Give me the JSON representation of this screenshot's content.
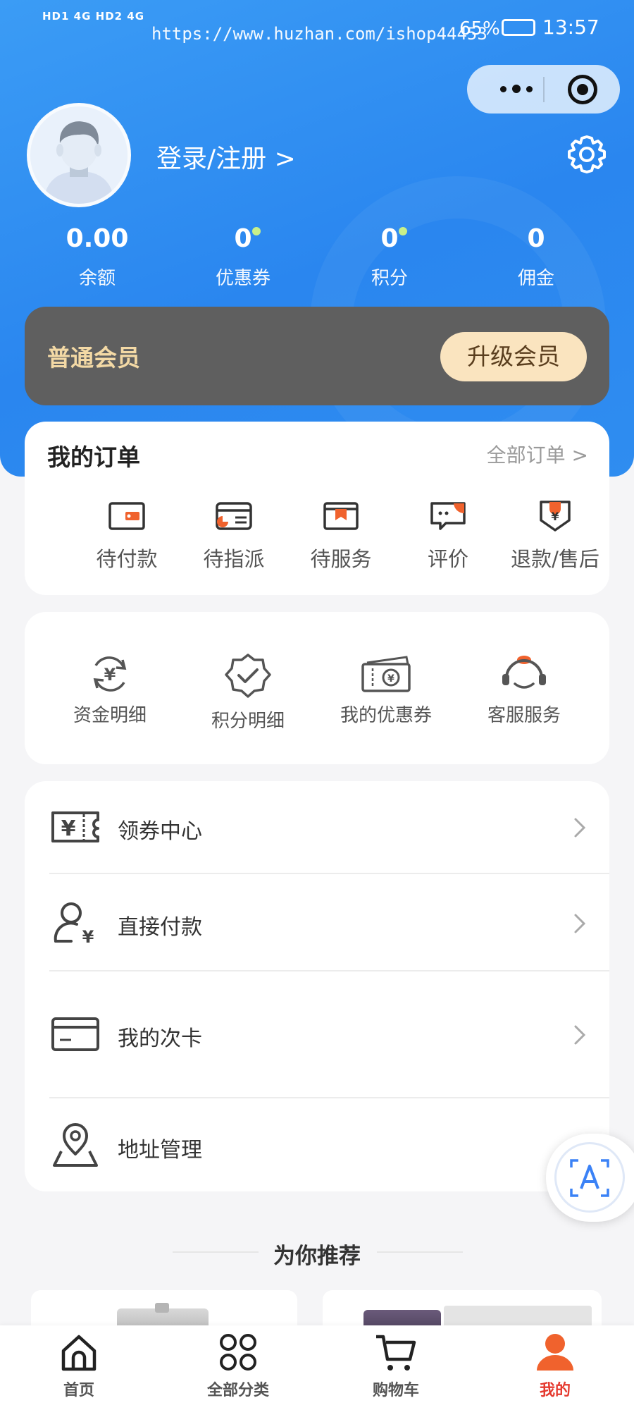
{
  "status_bar": {
    "network": "HD1 4G  HD2 4G",
    "watermark_url": "https://www.huzhan.com/ishop44453",
    "battery": "65%",
    "time": "13:57"
  },
  "header": {
    "login_label": "登录/注册 >",
    "stats": [
      {
        "value": "0.00",
        "label": "余额"
      },
      {
        "value": "0",
        "label": "优惠券"
      },
      {
        "value": "0",
        "label": "积分"
      },
      {
        "value": "0",
        "label": "佣金"
      }
    ]
  },
  "membership": {
    "level": "普通会员",
    "upgrade_label": "升级会员"
  },
  "orders": {
    "title": "我的订单",
    "all_label": "全部订单 >",
    "items": [
      {
        "label": "待付款",
        "icon": "wallet-icon"
      },
      {
        "label": "待指派",
        "icon": "card-icon"
      },
      {
        "label": "待服务",
        "icon": "box-icon"
      },
      {
        "label": "评价",
        "icon": "comment-icon"
      },
      {
        "label": "退款/售后",
        "icon": "refund-icon"
      }
    ]
  },
  "tools": [
    {
      "label": "资金明细",
      "icon": "funds-icon"
    },
    {
      "label": "积分明细",
      "icon": "badge-check-icon"
    },
    {
      "label": "我的优惠券",
      "icon": "ticket-icon"
    },
    {
      "label": "客服服务",
      "icon": "customer-service-icon"
    }
  ],
  "menu": [
    {
      "label": "领券中心",
      "icon": "coupon-icon"
    },
    {
      "label": "直接付款",
      "icon": "user-pay-icon"
    },
    {
      "label": "我的次卡",
      "icon": "bank-card-icon"
    },
    {
      "label": "地址管理",
      "icon": "map-pin-icon"
    }
  ],
  "recommend": {
    "title": "为你推荐"
  },
  "tabbar": [
    {
      "label": "首页",
      "icon": "home-icon",
      "active": false
    },
    {
      "label": "全部分类",
      "icon": "category-icon",
      "active": false
    },
    {
      "label": "购物车",
      "icon": "cart-icon",
      "active": false
    },
    {
      "label": "我的",
      "icon": "profile-icon",
      "active": true
    }
  ],
  "colors": {
    "hero_blue": "#2a86ef",
    "member_bg": "#5f5f5f",
    "member_gold": "#f3d9a5",
    "accent_orange": "#f0622d",
    "active_tab": "#e53a2f"
  }
}
